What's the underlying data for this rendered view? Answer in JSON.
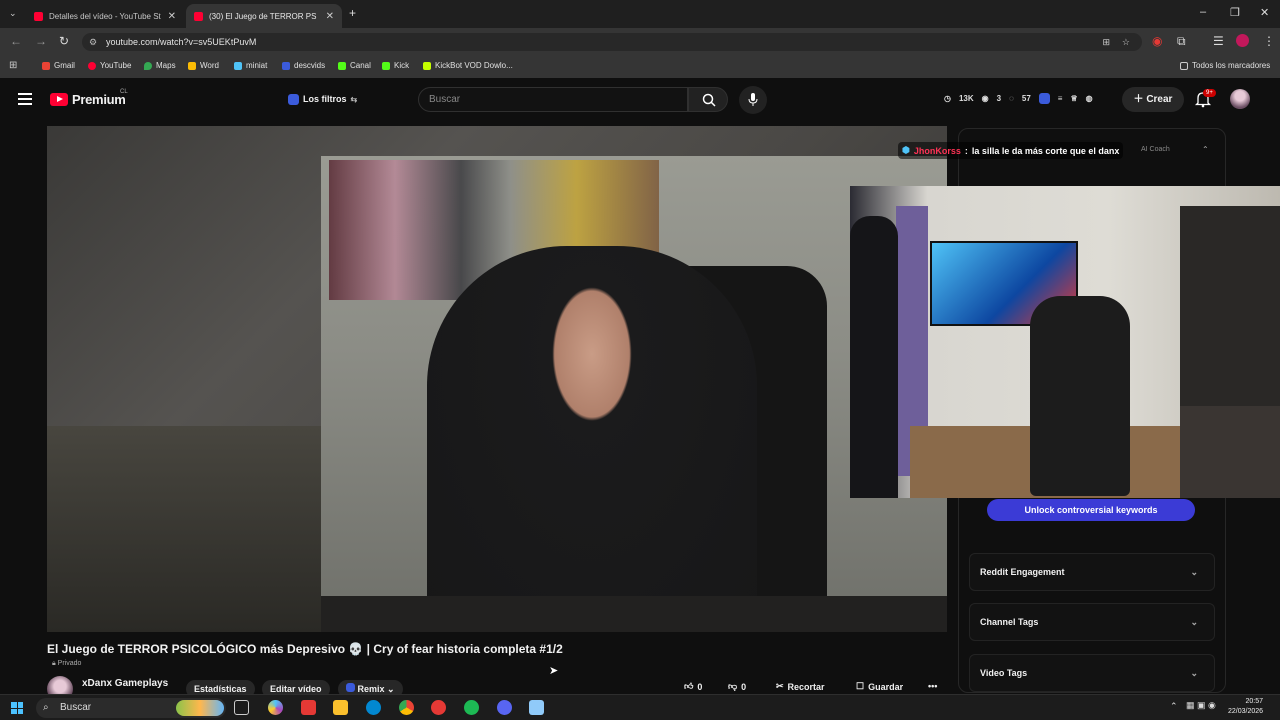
{
  "browser": {
    "tabs": [
      {
        "title": "Detalles del vídeo - YouTube St",
        "active": false
      },
      {
        "title": "(30) El Juego de TERROR PS",
        "active": true
      }
    ],
    "url": "youtube.com/watch?v=sv5UEKtPuvM",
    "bookmarks": [
      "Gmail",
      "YouTube",
      "Maps",
      "Word",
      "miniat",
      "descvids",
      "Canal",
      "Kick",
      "KickBot VOD Dowlo...",
      "Todos los marcadores"
    ]
  },
  "youtube": {
    "brand": "Premium",
    "region": "CL",
    "filters_label": "Los filtros",
    "search_placeholder": "Buscar",
    "stats": [
      "13K",
      "3",
      "57"
    ],
    "create_label": "Crear",
    "notif_count": "9+"
  },
  "chat": {
    "user": "JhonKorss",
    "separator": ":",
    "message": "la silla le da más corte que el danx"
  },
  "panel": {
    "ai_coach": "AI Coach",
    "unlock_button": "Unlock controversial keywords",
    "sections": [
      "Reddit Engagement",
      "Channel Tags",
      "Video Tags"
    ]
  },
  "video": {
    "title": "El Juego de TERROR PSICOLÓGICO más Depresivo 💀 | Cry of fear historia completa #1/2",
    "privacy": "Privado",
    "channel": "xDanx Gameplays",
    "buttons": [
      "Estadísticas",
      "Editar vídeo",
      "Remix"
    ],
    "likes": "0",
    "dislikes": "0",
    "clip_label": "Recortar",
    "save_label": "Guardar"
  },
  "taskbar": {
    "search_label": "Buscar",
    "time": "20:57",
    "date": "22/03/2026"
  },
  "colors": {
    "youtube_red": "#ff0033",
    "unlock_blue": "#3b3bd6",
    "chat_user": "#ff3355"
  }
}
